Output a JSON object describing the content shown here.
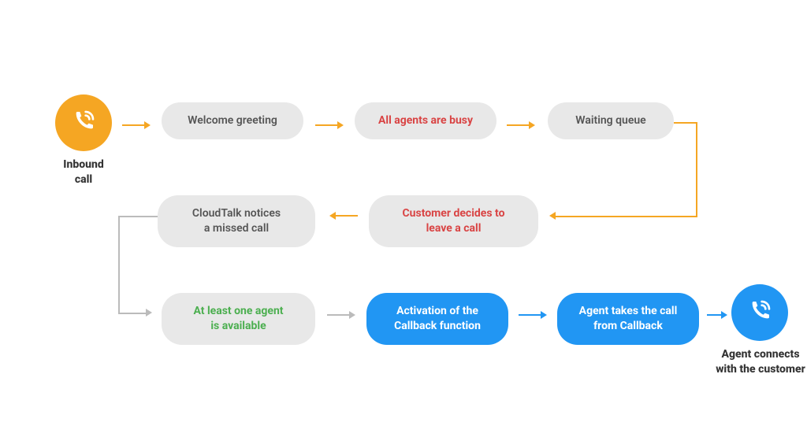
{
  "start": {
    "label": "Inbound\ncall"
  },
  "row1": {
    "welcome": "Welcome greeting",
    "busy": "All agents are busy",
    "queue": "Waiting queue"
  },
  "row2": {
    "leave": "Customer decides to\nleave a call",
    "missed": "CloudTalk notices\na missed call"
  },
  "row3": {
    "available": "At least one agent\nis available",
    "activation": "Activation of the\nCallback function",
    "takes": "Agent takes the call\nfrom Callback"
  },
  "end": {
    "label": "Agent connects\nwith the customer"
  },
  "colors": {
    "orange": "#f5a623",
    "blue": "#2196f3",
    "red": "#d94444",
    "green": "#4caf50",
    "gray": "#e8e8e8"
  }
}
